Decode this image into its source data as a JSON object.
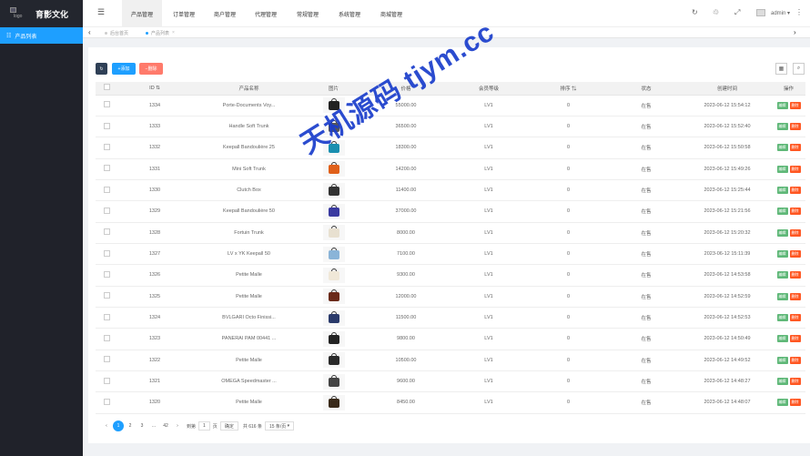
{
  "app": {
    "logo_alt": "logo",
    "brand": "育影文化"
  },
  "sidebar": {
    "items": [
      {
        "label": "产品列表"
      }
    ]
  },
  "header": {
    "nav": [
      {
        "label": "产品管理"
      },
      {
        "label": "订单管理"
      },
      {
        "label": "商户管理"
      },
      {
        "label": "代理管理"
      },
      {
        "label": "常规管理"
      },
      {
        "label": "系统管理"
      },
      {
        "label": "商城管理"
      }
    ],
    "user": "admin"
  },
  "tabs": [
    {
      "label": "后台首页"
    },
    {
      "label": "产品列表"
    }
  ],
  "toolbar": {
    "add_label": "添加",
    "delete_label": "删除"
  },
  "table": {
    "headers": [
      "ID",
      "产品名称",
      "图片",
      "价格",
      "会员等级",
      "排序",
      "状态",
      "创建时间",
      "操作"
    ],
    "edit_label": "编辑",
    "delete_label": "删除",
    "rows": [
      {
        "id": "1334",
        "name": "Porte-Documents Voy...",
        "price": "55000.00",
        "level": "LV1",
        "sort": "0",
        "status": "在售",
        "time": "2023-06-12 15:54:12",
        "img": "#222"
      },
      {
        "id": "1333",
        "name": "Handle Soft Trunk",
        "price": "36500.00",
        "level": "LV1",
        "sort": "0",
        "status": "在售",
        "time": "2023-06-12 15:52:40",
        "img": "#555"
      },
      {
        "id": "1332",
        "name": "Keepall Bandoulière 25",
        "price": "18300.00",
        "level": "LV1",
        "sort": "0",
        "status": "在售",
        "time": "2023-06-12 15:50:58",
        "img": "#1a8fb0"
      },
      {
        "id": "1331",
        "name": "Mini Soft Trunk",
        "price": "14200.00",
        "level": "LV1",
        "sort": "0",
        "status": "在售",
        "time": "2023-06-12 15:49:26",
        "img": "#e0601a"
      },
      {
        "id": "1330",
        "name": "Clutch Box",
        "price": "11400.00",
        "level": "LV1",
        "sort": "0",
        "status": "在售",
        "time": "2023-06-12 15:25:44",
        "img": "#333"
      },
      {
        "id": "1329",
        "name": "Keepall Bandoulière 50",
        "price": "37000.00",
        "level": "LV1",
        "sort": "0",
        "status": "在售",
        "time": "2023-06-12 15:21:56",
        "img": "#3a3aa0"
      },
      {
        "id": "1328",
        "name": "Fortuin Trunk",
        "price": "8000.00",
        "level": "LV1",
        "sort": "0",
        "status": "在售",
        "time": "2023-06-12 15:20:32",
        "img": "#e8e0d0"
      },
      {
        "id": "1327",
        "name": "LV x YK Keepall 50",
        "price": "7100.00",
        "level": "LV1",
        "sort": "0",
        "status": "在售",
        "time": "2023-06-12 15:11:39",
        "img": "#8ab4d8"
      },
      {
        "id": "1326",
        "name": "Petite Malle",
        "price": "9300.00",
        "level": "LV1",
        "sort": "0",
        "status": "在售",
        "time": "2023-06-12 14:53:58",
        "img": "#f0e8d8"
      },
      {
        "id": "1325",
        "name": "Petite Malle",
        "price": "12000.00",
        "level": "LV1",
        "sort": "0",
        "status": "在售",
        "time": "2023-06-12 14:52:59",
        "img": "#6a2a1a"
      },
      {
        "id": "1324",
        "name": "BVLGARI Octo Finissi...",
        "price": "11500.00",
        "level": "LV1",
        "sort": "0",
        "status": "在售",
        "time": "2023-06-12 14:52:53",
        "img": "#2a3a6a"
      },
      {
        "id": "1323",
        "name": "PANERAI PAM 00441 ...",
        "price": "9800.00",
        "level": "LV1",
        "sort": "0",
        "status": "在售",
        "time": "2023-06-12 14:50:49",
        "img": "#222"
      },
      {
        "id": "1322",
        "name": "Petite Malle",
        "price": "10500.00",
        "level": "LV1",
        "sort": "0",
        "status": "在售",
        "time": "2023-06-12 14:49:52",
        "img": "#2a2a2a"
      },
      {
        "id": "1321",
        "name": "OMEGA Speedmaster ...",
        "price": "9600.00",
        "level": "LV1",
        "sort": "0",
        "status": "在售",
        "time": "2023-06-12 14:48:27",
        "img": "#444"
      },
      {
        "id": "1320",
        "name": "Petite Malle",
        "price": "8450.00",
        "level": "LV1",
        "sort": "0",
        "status": "在售",
        "time": "2023-06-12 14:48:07",
        "img": "#3a2a1a"
      }
    ]
  },
  "pager": {
    "pages": [
      "1",
      "2",
      "3",
      "...",
      "42"
    ],
    "goto_label": "到第",
    "goto_value": "1",
    "page_unit": "页",
    "confirm_label": "确定",
    "total": "共 616 条",
    "page_size": "15 条/页"
  },
  "watermark": "天机源码 tjym.cc",
  "colors": {
    "primary": "#1e9fff",
    "sidebar": "#20222a",
    "edit": "#5fb878",
    "danger": "#ff5722"
  }
}
